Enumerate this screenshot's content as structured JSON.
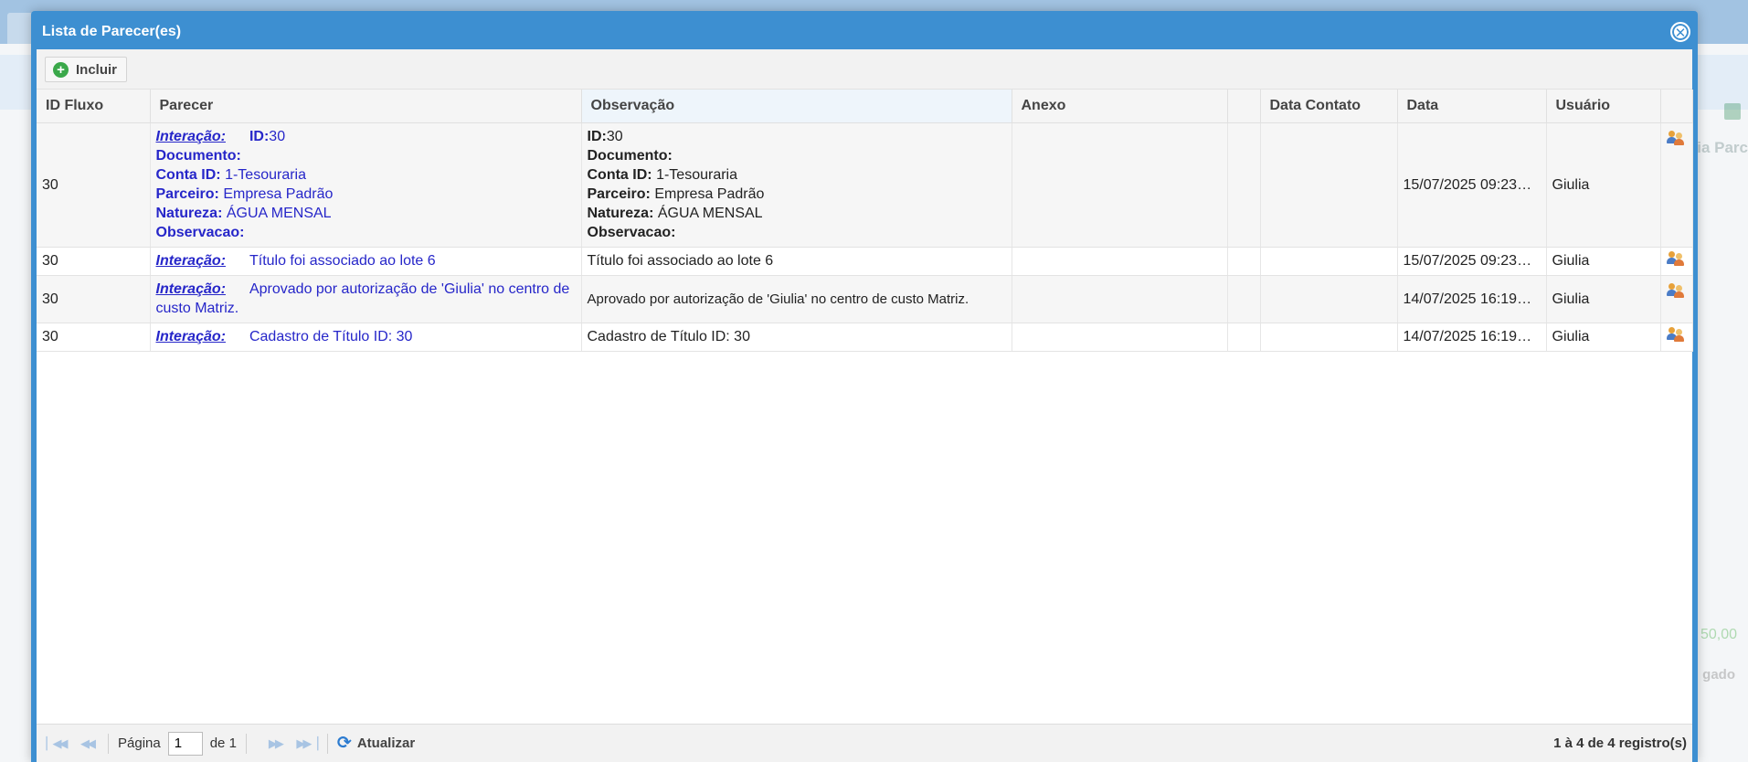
{
  "modal": {
    "title": "Lista de Parecer(es)",
    "close_symbol": "✕",
    "toolbar": {
      "add_label": "Incluir",
      "add_symbol": "+"
    }
  },
  "table": {
    "columns": [
      "ID Fluxo",
      "Parecer",
      "Observação",
      "Anexo",
      "",
      "Data Contato",
      "Data",
      "Usuário",
      ""
    ],
    "rows": [
      {
        "id_fluxo": "30",
        "parecer": {
          "link": "Interação:",
          "id_label": "ID:",
          "id_value": "30",
          "documento_label": "Documento:",
          "conta_label": "Conta ID:",
          "conta_value": "1-Tesouraria",
          "parceiro_label": "Parceiro:",
          "parceiro_value": "Empresa Padrão",
          "natureza_label": "Natureza:",
          "natureza_value": "ÁGUA MENSAL",
          "observacao_label": "Observacao:"
        },
        "observacao": {
          "id_label": "ID:",
          "id_value": "30",
          "documento_label": "Documento:",
          "conta_label": "Conta ID:",
          "conta_value": "1-Tesouraria",
          "parceiro_label": "Parceiro:",
          "parceiro_value": "Empresa Padrão",
          "natureza_label": "Natureza:",
          "natureza_value": "ÁGUA MENSAL",
          "observacao_label": "Observacao:"
        },
        "anexo": "",
        "data_contato": "",
        "data": "15/07/2025 09:23…",
        "usuario": "Giulia"
      },
      {
        "id_fluxo": "30",
        "parecer": {
          "link": "Interação:",
          "text": "Título foi associado ao lote 6"
        },
        "observacao": "Título foi associado ao lote 6",
        "anexo": "",
        "data_contato": "",
        "data": "15/07/2025 09:23…",
        "usuario": "Giulia"
      },
      {
        "id_fluxo": "30",
        "parecer": {
          "link": "Interação:",
          "text": "Aprovado por autorização de 'Giulia' no centro de custo Matriz."
        },
        "observacao": "Aprovado por autorização de 'Giulia' no centro de custo Matriz.",
        "anexo": "",
        "data_contato": "",
        "data": "14/07/2025 16:19…",
        "usuario": "Giulia"
      },
      {
        "id_fluxo": "30",
        "parecer": {
          "link": "Interação:",
          "text": "Cadastro de Título ID: 30"
        },
        "observacao": "Cadastro de Título ID: 30",
        "anexo": "",
        "data_contato": "",
        "data": "14/07/2025 16:19…",
        "usuario": "Giulia"
      }
    ]
  },
  "footer": {
    "page_label": "Página",
    "page_value": "1",
    "of_label": "de 1",
    "refresh_label": "Atualizar",
    "records_label": "1 à 4 de 4 registro(s)",
    "icons": [
      "first-page-icon",
      "prev-page-icon",
      "next-page-icon",
      "last-page-icon",
      "refresh-icon"
    ]
  },
  "background": {
    "side_text": "ria Parc",
    "green_value": "50,00",
    "gray_text": "gado"
  },
  "colors": {
    "modal_header": "#3d8fd1",
    "link_blue": "#2626c9",
    "add_green": "#3aa84a"
  }
}
